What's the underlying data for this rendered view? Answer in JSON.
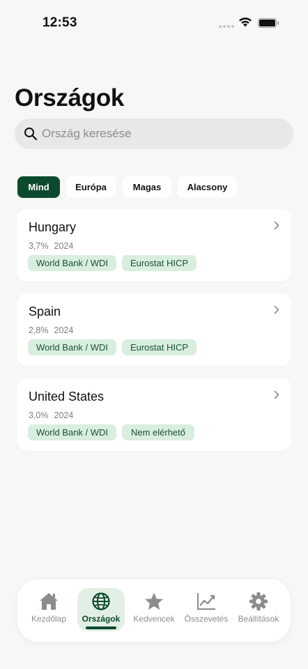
{
  "status_bar": {
    "time": "12:53"
  },
  "page": {
    "title": "Országok"
  },
  "search": {
    "placeholder": "Ország keresése"
  },
  "filters": [
    {
      "label": "Mind",
      "active": true
    },
    {
      "label": "Európa",
      "active": false
    },
    {
      "label": "Magas",
      "active": false
    },
    {
      "label": "Alacsony",
      "active": false
    }
  ],
  "countries": [
    {
      "name": "Hungary",
      "value": "3,7%",
      "year": "2024",
      "sources": [
        "World Bank / WDI",
        "Eurostat HICP"
      ]
    },
    {
      "name": "Spain",
      "value": "2,8%",
      "year": "2024",
      "sources": [
        "World Bank / WDI",
        "Eurostat HICP"
      ]
    },
    {
      "name": "United States",
      "value": "3,0%",
      "year": "2024",
      "sources": [
        "World Bank / WDI",
        "Nem elérhető"
      ]
    }
  ],
  "tab_bar": {
    "tabs": [
      {
        "label": "Kezdőlap",
        "icon": "home-icon",
        "active": false
      },
      {
        "label": "Országok",
        "icon": "globe-icon",
        "active": true
      },
      {
        "label": "Kedvencek",
        "icon": "star-icon",
        "active": false
      },
      {
        "label": "Összevetés",
        "icon": "chart-icon",
        "active": false
      },
      {
        "label": "Beállítások",
        "icon": "gear-icon",
        "active": false
      }
    ]
  },
  "colors": {
    "accent": "#0d4a2d",
    "badge_bg": "#d9eedf",
    "badge_text": "#1a5233",
    "background": "#f6f8f5"
  }
}
